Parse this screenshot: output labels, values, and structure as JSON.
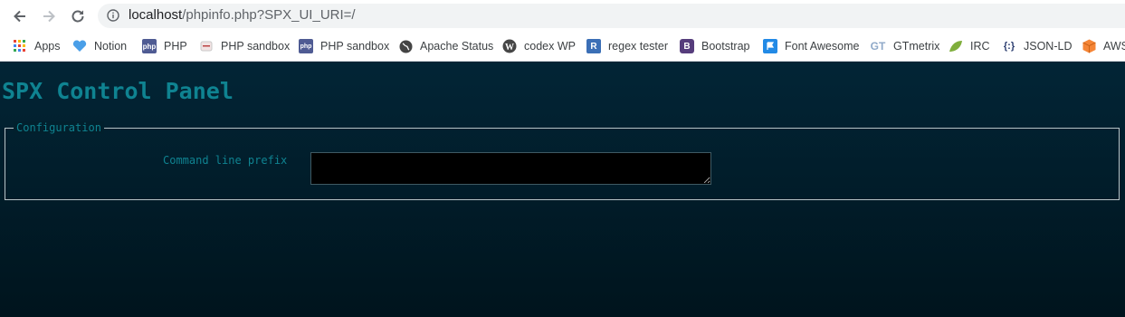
{
  "browser": {
    "url_host": "localhost",
    "url_rest": "/phpinfo.php?SPX_UI_URI=/",
    "bookmarks": [
      {
        "label": "Apps",
        "icon": "apps-grid-icon",
        "color": "#ea4335"
      },
      {
        "label": "Notion",
        "icon": "heart-icon",
        "color": "#4a9fe8"
      },
      {
        "label": "PHP",
        "icon": "php-icon",
        "color": "#4f5b93"
      },
      {
        "label": "PHP sandbox",
        "icon": "sandbox-icon",
        "color": "#c8c8c8"
      },
      {
        "label": "PHP sandbox",
        "icon": "php-sandbox-icon",
        "color": "#4f5b93"
      },
      {
        "label": "Apache Status",
        "icon": "globe-icon",
        "color": "#444444"
      },
      {
        "label": "codex WP",
        "icon": "wordpress-icon",
        "color": "#464646"
      },
      {
        "label": "regex tester",
        "icon": "regex-r-icon",
        "color": "#3b6fb6"
      },
      {
        "label": "Bootstrap",
        "icon": "bootstrap-b-icon",
        "color": "#563d7c"
      },
      {
        "label": "Font Awesome",
        "icon": "flag-icon",
        "color": "#228ae6"
      },
      {
        "label": "GTmetrix",
        "icon": "gtmetrix-icon",
        "color": "#8fa9c8"
      },
      {
        "label": "IRC",
        "icon": "leaf-icon",
        "color": "#7fae3c"
      },
      {
        "label": "JSON-LD",
        "icon": "json-braces-icon",
        "color": "#2c3e70"
      },
      {
        "label": "AWS",
        "icon": "cube-icon",
        "color": "#f58536"
      }
    ]
  },
  "page": {
    "title": "SPX Control Panel",
    "config": {
      "legend": "Configuration",
      "command_label": "Command line prefix",
      "command_value": ""
    }
  }
}
